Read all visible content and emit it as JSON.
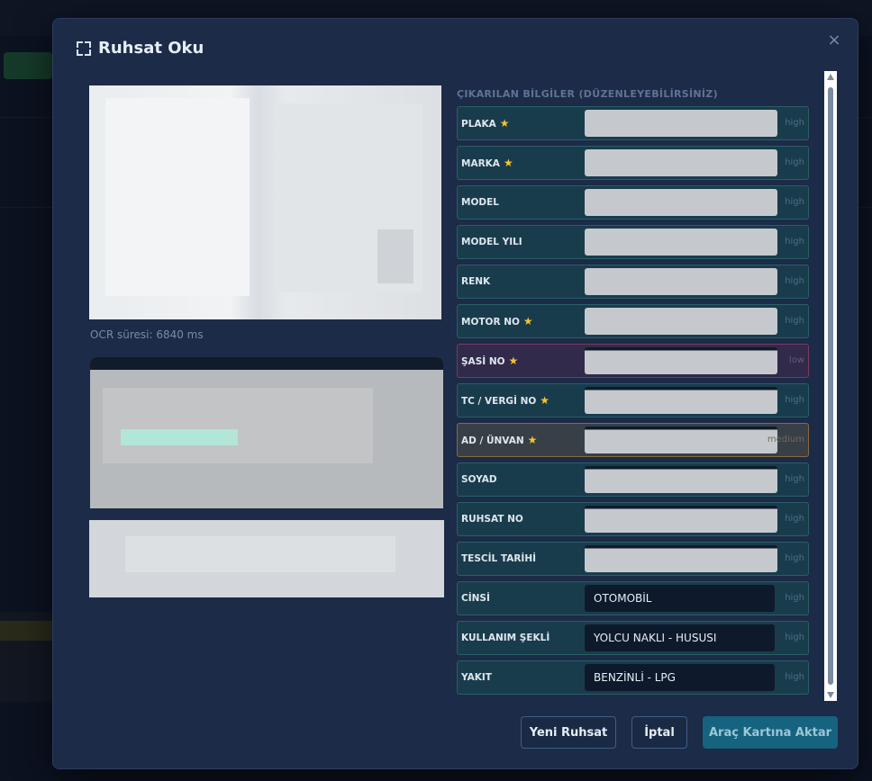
{
  "modal": {
    "title": "Ruhsat Oku",
    "close_label": "×"
  },
  "left": {
    "ocr_time": "OCR süresi: 6840 ms"
  },
  "right": {
    "section_title": "ÇIKARILAN BİLGİLER (DÜZENLEYEBİLİRSİNİZ)",
    "fields": [
      {
        "label": "PLAKA",
        "required": true,
        "value": "",
        "confidence": "high"
      },
      {
        "label": "MARKA",
        "required": true,
        "value": "",
        "confidence": "high"
      },
      {
        "label": "MODEL",
        "required": false,
        "value": "",
        "confidence": "high"
      },
      {
        "label": "MODEL YILI",
        "required": false,
        "value": "",
        "confidence": "high"
      },
      {
        "label": "RENK",
        "required": false,
        "value": "",
        "confidence": "high"
      },
      {
        "label": "MOTOR NO",
        "required": true,
        "value": "",
        "confidence": "high"
      },
      {
        "label": "ŞASİ NO",
        "required": true,
        "value": "",
        "confidence": "low"
      },
      {
        "label": "TC / VERGİ NO",
        "required": true,
        "value": "",
        "confidence": "high"
      },
      {
        "label": "AD / ÜNVAN",
        "required": true,
        "value": "",
        "confidence": "medium"
      },
      {
        "label": "SOYAD",
        "required": false,
        "value": "",
        "confidence": "high"
      },
      {
        "label": "RUHSAT NO",
        "required": false,
        "value": "",
        "confidence": "high"
      },
      {
        "label": "TESCİL TARİHİ",
        "required": false,
        "value": "",
        "confidence": "high"
      },
      {
        "label": "CİNSİ",
        "required": false,
        "value": "OTOMOBİL",
        "confidence": "high"
      },
      {
        "label": "KULLANIM ŞEKLİ",
        "required": false,
        "value": "YOLCU NAKLI - HUSUSI",
        "confidence": "high"
      },
      {
        "label": "YAKIT",
        "required": false,
        "value": "BENZİNLİ - LPG",
        "confidence": "high"
      }
    ]
  },
  "footer": {
    "new_label": "Yeni Ruhsat",
    "cancel_label": "İptal",
    "primary_label": "Araç Kartına Aktar"
  },
  "colors": {
    "modal_bg": "#1c2b47",
    "field_high_bg": "#193c4c",
    "field_low_bg": "#322a4a",
    "field_medium_bg": "#393f46",
    "star": "#f4c430",
    "primary_button": "#16637f"
  },
  "icons": {
    "title_icon": "focus-frame-icon",
    "required_icon": "star-icon",
    "close_icon": "close-icon"
  }
}
